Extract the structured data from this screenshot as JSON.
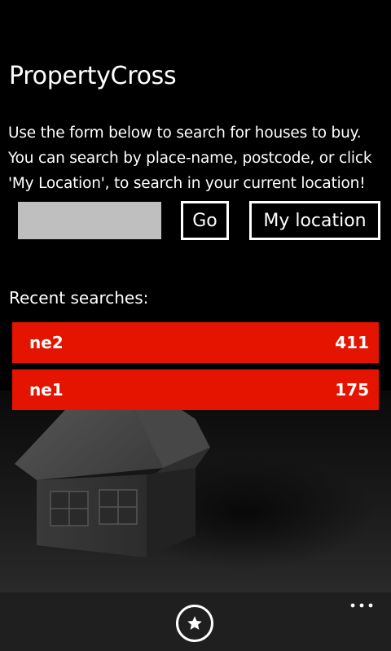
{
  "app": {
    "title": "PropertyCross"
  },
  "intro_text": "Use the form below to search for houses to buy. You can search by place-name, postcode, or click 'My Location', to search in your current location!",
  "search": {
    "value": "",
    "placeholder": "",
    "go_label": "Go",
    "location_label": "My location"
  },
  "recent": {
    "label": "Recent searches:",
    "items": [
      {
        "name": "ne2",
        "count": "411"
      },
      {
        "name": "ne1",
        "count": "175"
      }
    ]
  },
  "appbar": {
    "favourites_icon": "star-icon",
    "more_icon": "ellipsis-icon"
  },
  "colors": {
    "accent": "#e51400",
    "background": "#000000",
    "input": "#bfbfbf",
    "appbar": "#1f1f1f"
  }
}
